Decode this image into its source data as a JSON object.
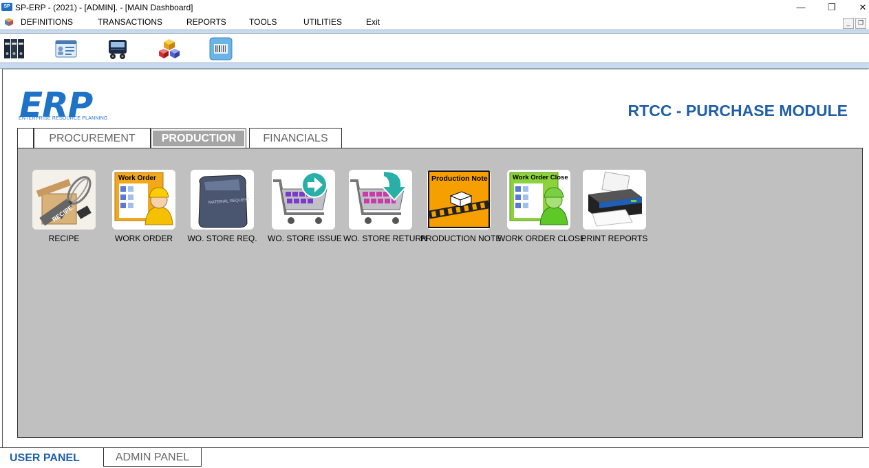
{
  "window": {
    "title": "SP-ERP - (2021) - [ADMIN]. - [MAIN Dashboard]",
    "app_icon_text": "SP",
    "minimize": "—",
    "restore": "❐",
    "close": "✕"
  },
  "menu": {
    "items": [
      "DEFINITIONS",
      "TRANSACTIONS",
      "REPORTS",
      "TOOLS",
      "UTILITIES",
      "Exit"
    ],
    "mdi_minimize": "_",
    "mdi_restore": "❐"
  },
  "toolbar": {
    "icons": [
      "binders-icon",
      "id-card-icon",
      "truck-icon",
      "cubes-icon",
      "barcode-icon"
    ]
  },
  "logo": {
    "main": "ERP",
    "sub": "ENTERPRISE RESOURCE PLANNING"
  },
  "module_title": "RTCC - PURCHASE MODULE",
  "tabs": {
    "items": [
      "PROCUREMENT",
      "PRODUCTION",
      "FINANCIALS"
    ],
    "active": "PRODUCTION"
  },
  "modules": [
    {
      "label": "RECIPE",
      "icon": "recipe-icon",
      "icon_text": "RECIPE"
    },
    {
      "label": "WORK ORDER",
      "icon": "work-order-icon",
      "icon_text": "Work Order"
    },
    {
      "label": "WO. STORE REQ.",
      "icon": "material-request-icon",
      "icon_text": "MATERIAL REQUEST"
    },
    {
      "label": "WO. STORE ISSUE",
      "icon": "cart-issue-icon"
    },
    {
      "label": "WO. STORE RETURN",
      "icon": "cart-return-icon"
    },
    {
      "label": "PRODUCTION NOTE",
      "icon": "production-note-icon",
      "icon_text": "Production Note"
    },
    {
      "label": "WORK ORDER CLOSE",
      "icon": "work-order-close-icon",
      "icon_text": "Work Order Close"
    },
    {
      "label": "PRINT REPORTS",
      "icon": "printer-icon"
    }
  ],
  "bottom_tabs": {
    "user": "USER PANEL",
    "admin": "ADMIN PANEL"
  },
  "colors": {
    "accent": "#1f5fa8",
    "logo": "#1f73c7",
    "panel_bg": "#c0c0c0",
    "separator": "#c9dbf0"
  }
}
